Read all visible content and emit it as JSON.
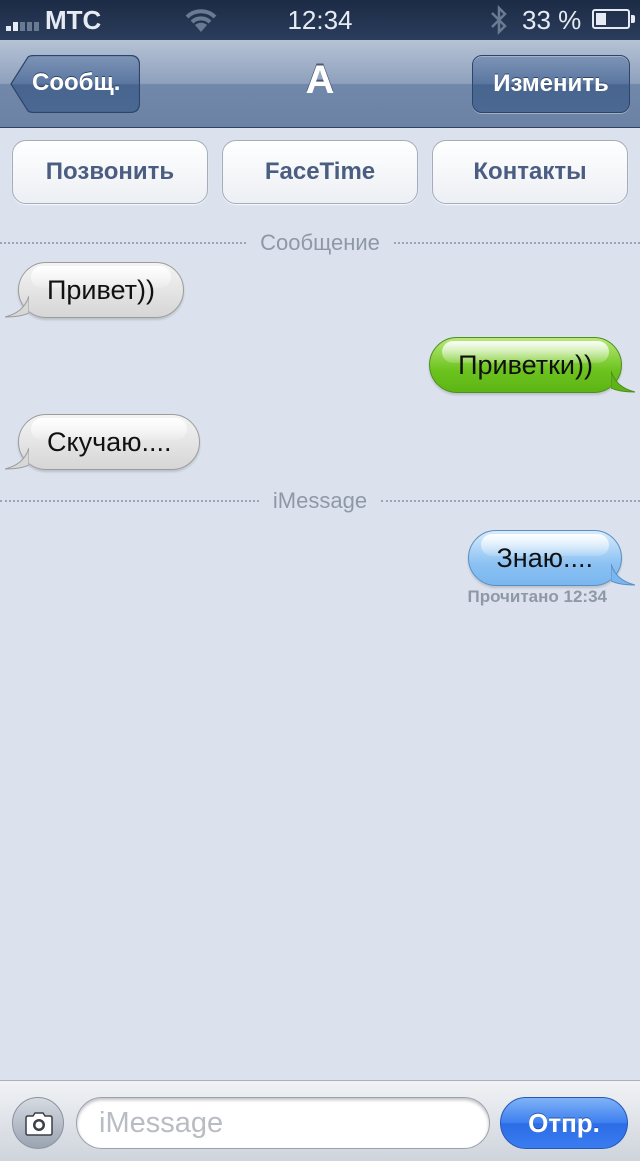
{
  "status_bar": {
    "carrier": "МТС",
    "time": "12:34",
    "battery_percent": "33 %",
    "battery_level": 0.33
  },
  "nav": {
    "back_label": "Сообщ.",
    "title": "А",
    "edit_label": "Изменить"
  },
  "actions": {
    "call": "Позвонить",
    "facetime": "FaceTime",
    "contacts": "Контакты"
  },
  "dividers": {
    "sms": "Сообщение",
    "imessage": "iMessage"
  },
  "messages": [
    {
      "direction": "incoming",
      "text": "Привет))"
    },
    {
      "direction": "outgoing",
      "service": "sms",
      "text": "Приветки))"
    },
    {
      "direction": "incoming",
      "text": "Скучаю...."
    },
    {
      "direction": "outgoing",
      "service": "imessage",
      "text": "Знаю...."
    }
  ],
  "read_receipt": "Прочитано 12:34",
  "composer": {
    "placeholder": "iMessage",
    "send_label": "Отпр."
  },
  "colors": {
    "background": "#dbe2ed",
    "sms_bubble": "#6cc31e",
    "imessage_bubble": "#8cc2f3",
    "incoming_bubble": "#e4e4e4",
    "send_button": "#3a7cf0"
  },
  "icons": [
    "signal-icon",
    "wifi-icon",
    "bluetooth-icon",
    "battery-icon",
    "back-chevron-icon",
    "camera-icon"
  ]
}
